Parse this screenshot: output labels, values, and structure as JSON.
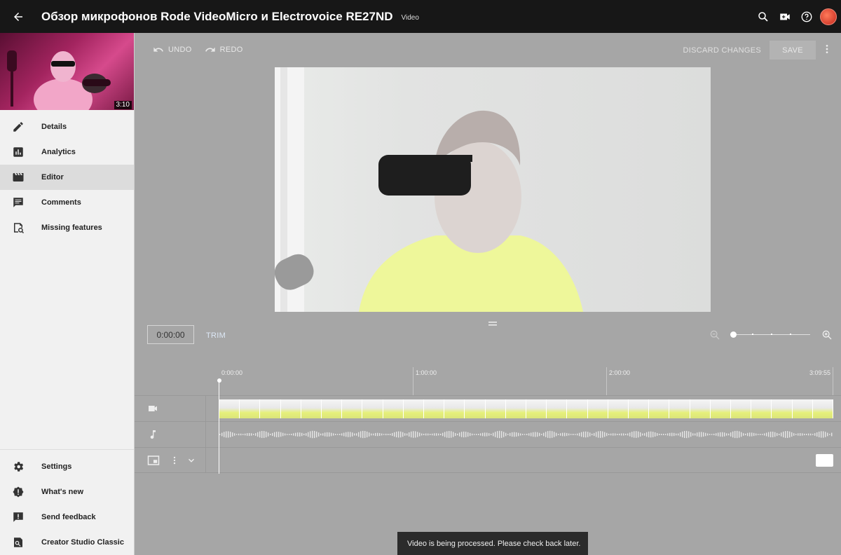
{
  "header": {
    "title": "Обзор микрофонов Rode VideoMicro и Electrovoice RE27ND",
    "subtitle": "Video",
    "icons": [
      "back-arrow-icon",
      "search-icon",
      "create-video-icon",
      "help-icon",
      "avatar"
    ]
  },
  "sidebar": {
    "thumbnail_duration": "3:10",
    "items": [
      {
        "label": "Details",
        "icon": "pencil-icon"
      },
      {
        "label": "Analytics",
        "icon": "bar-chart-icon"
      },
      {
        "label": "Editor",
        "icon": "clapperboard-icon",
        "active": true
      },
      {
        "label": "Comments",
        "icon": "comment-icon"
      },
      {
        "label": "Missing features",
        "icon": "missing-features-icon"
      }
    ],
    "bottom_items": [
      {
        "label": "Settings",
        "icon": "gear-icon"
      },
      {
        "label": "What's new",
        "icon": "alert-badge-icon"
      },
      {
        "label": "Send feedback",
        "icon": "feedback-icon"
      },
      {
        "label": "Creator Studio Classic",
        "icon": "classic-studio-icon"
      }
    ]
  },
  "toolbar": {
    "undo_label": "UNDO",
    "redo_label": "REDO",
    "discard_label": "DISCARD CHANGES",
    "save_label": "SAVE"
  },
  "timeline": {
    "current_time": "0:00:00",
    "trim_label": "TRIM",
    "ruler_labels": [
      "0:00:00",
      "1:00:00",
      "2:00:00",
      "3:09:55"
    ],
    "zoom_level": 0
  },
  "snackbar": {
    "message": "Video is being processed. Please check back later."
  },
  "colors": {
    "topbar": "#171717",
    "sidebar": "#f1f1f1",
    "editor_bg": "#a6a6a6",
    "active_item": "#dcdcdc",
    "trim_link": "#dde8f6",
    "snackbar": "#2b2b2b"
  }
}
